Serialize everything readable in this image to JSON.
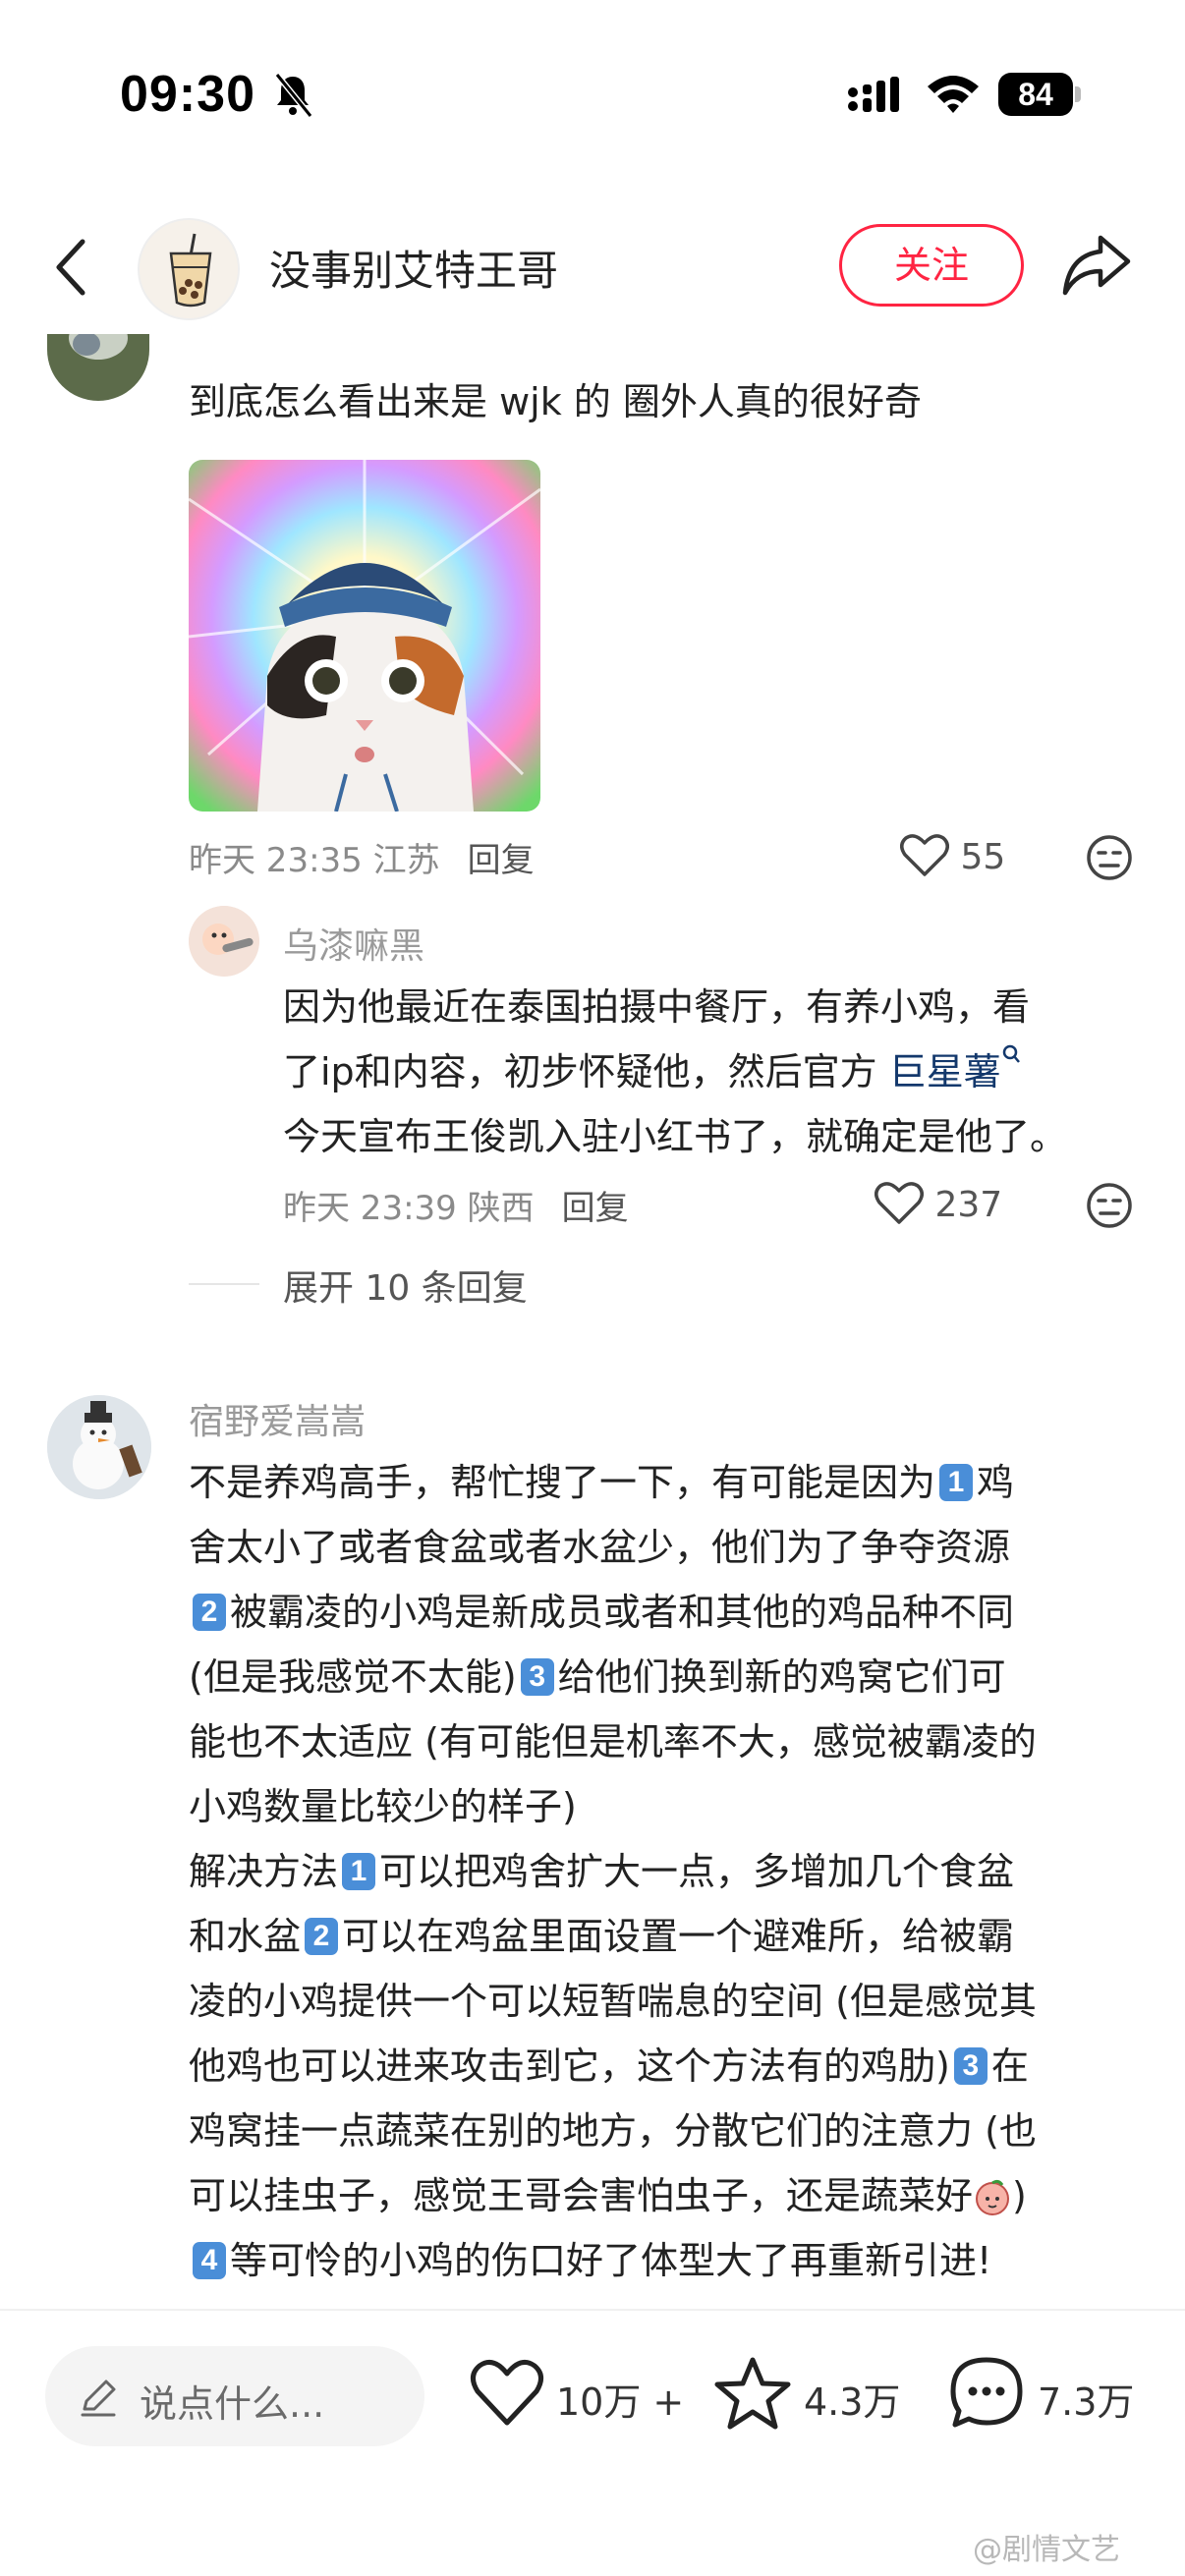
{
  "status": {
    "time": "09:30",
    "battery": "84"
  },
  "header": {
    "author": "没事别艾特王哥",
    "follow_label": "关注"
  },
  "comment1": {
    "text": "到底怎么看出来是 wjk 的 圈外人真的很好奇",
    "meta_time": "昨天 23:35 江苏",
    "reply_label": "回复",
    "likes": "55"
  },
  "reply1": {
    "username": "乌漆嘛黑",
    "text_line1": "因为他最近在泰国拍摄中餐厅，有养小鸡，看",
    "text_line2": "了ip和内容，初步怀疑他，然后官方 ",
    "topic": "巨星薯",
    "text_line3": "今天宣布王俊凯入驻小红书了，就确定是他了。",
    "meta_time": "昨天 23:39 陕西",
    "reply_label": "回复",
    "likes": "237"
  },
  "expand_label": "展开 10 条回复",
  "comment2": {
    "username": "宿野爱嵩嵩",
    "l1a": "不是养鸡高手，帮忙搜了一下，有可能是因为",
    "b1": "1",
    "l1b": "鸡",
    "l2": "舍太小了或者食盆或者水盆少，他们为了争夺资源",
    "b2": "2",
    "l3": "被霸凌的小鸡是新成员或者和其他的鸡品种不同",
    "l4a": "(但是我感觉不太能)",
    "b3": "3",
    "l4b": "给他们换到新的鸡窝它们可",
    "l5": "能也不太适应 (有可能但是机率不大，感觉被霸凌的",
    "l6": "小鸡数量比较少的样子)",
    "l7a": "解决方法",
    "b4": "1",
    "l7b": "可以把鸡舍扩大一点，多增加几个食盆",
    "l8a": "和水盆",
    "b5": "2",
    "l8b": "可以在鸡盆里面设置一个避难所，给被霸",
    "l9": "凌的小鸡提供一个可以短暂喘息的空间 (但是感觉其",
    "l10a": "他鸡也可以进来攻击到它，这个方法有的鸡肋)",
    "b6": "3",
    "l10b": "在",
    "l11": "鸡窝挂一点蔬菜在别的地方，分散它们的注意力 (也",
    "l12": "可以挂虫子，感觉王哥会害怕虫子，还是蔬菜好",
    "l12b": ")",
    "b7": "4",
    "l13": "等可怜的小鸡的伤口好了体型大了再重新引进!"
  },
  "bottom": {
    "input_placeholder": "说点什么...",
    "likes": "10万 +",
    "stars": "4.3万",
    "comments": "7.3万"
  },
  "watermark": "@剧情文艺",
  "colors": {
    "accent": "#ff2442",
    "link": "#13386c",
    "badge": "#4a8ed8"
  }
}
